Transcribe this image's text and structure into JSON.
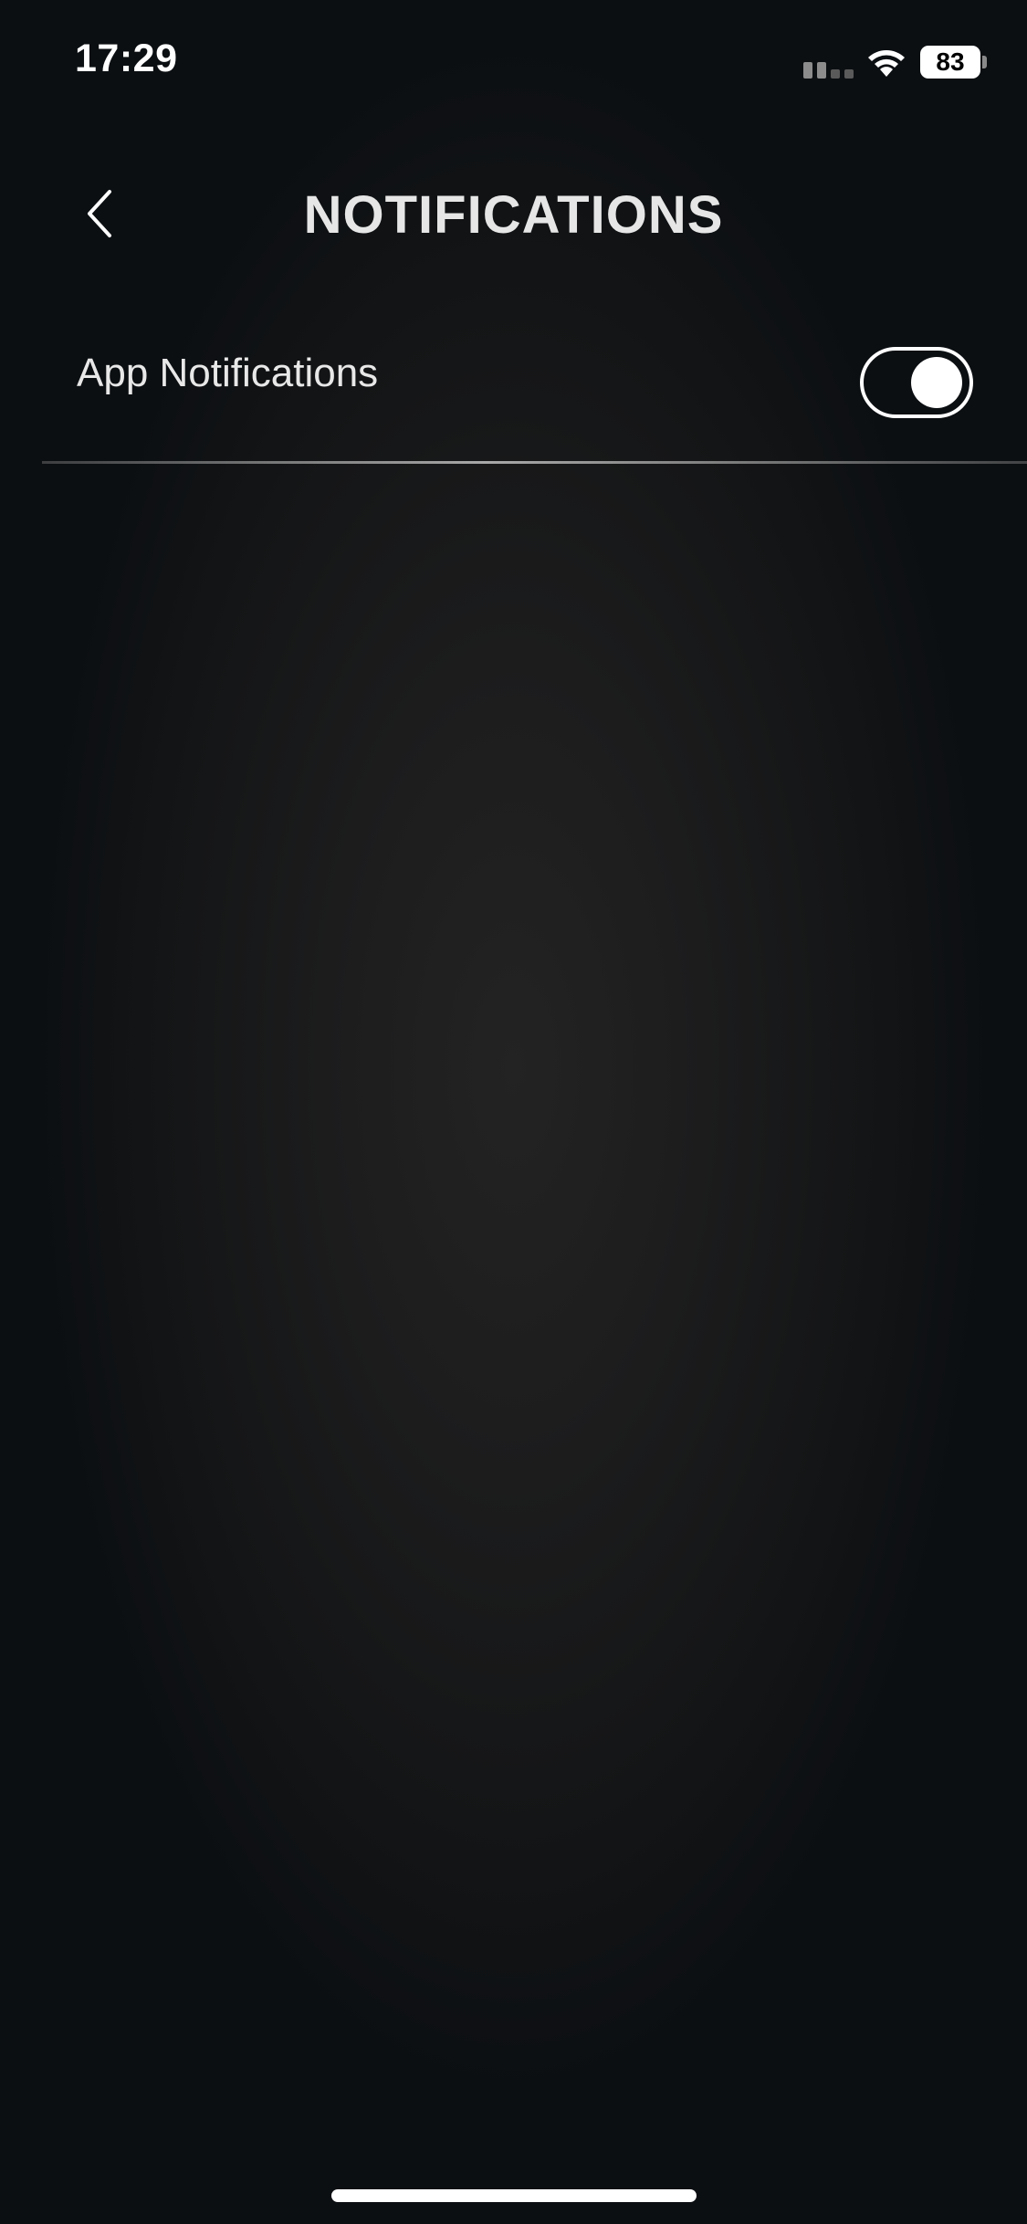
{
  "status_bar": {
    "time": "17:29",
    "signal_icon": "cellular-signal-icon",
    "wifi_icon": "wifi-icon",
    "battery_level": "83"
  },
  "header": {
    "back_icon": "chevron-left-icon",
    "title": "NOTIFICATIONS"
  },
  "settings": {
    "app_notifications": {
      "label": "App Notifications",
      "enabled": true
    }
  },
  "colors": {
    "background": "#1a1b1c",
    "text": "#e8e8e8",
    "toggle": "#ffffff"
  }
}
